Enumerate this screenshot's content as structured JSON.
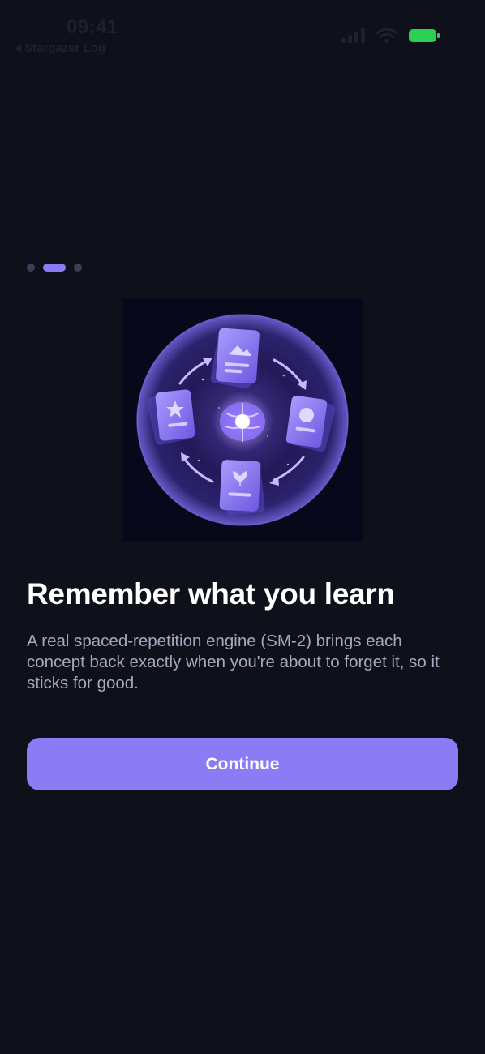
{
  "status_bar": {
    "time": "09:41",
    "back_app": "Stargazer Log",
    "icons": [
      "signal-icon",
      "wifi-icon",
      "battery-icon"
    ],
    "battery_color": "#2ccf4f"
  },
  "onboarding": {
    "page_count": 3,
    "active_page": 2,
    "illustration_icon": "brain-flashcards-cycle-illustration",
    "title": "Remember what you learn",
    "description": "A real spaced-repetition engine (SM-2) brings each concept back exactly when you're about to forget it, so it sticks for good.",
    "cta_label": "Continue"
  },
  "colors": {
    "background": "#0f111a",
    "accent": "#8b7cf6",
    "body_text": "#a5a9bd",
    "inactive_dot": "#3b3e55"
  }
}
